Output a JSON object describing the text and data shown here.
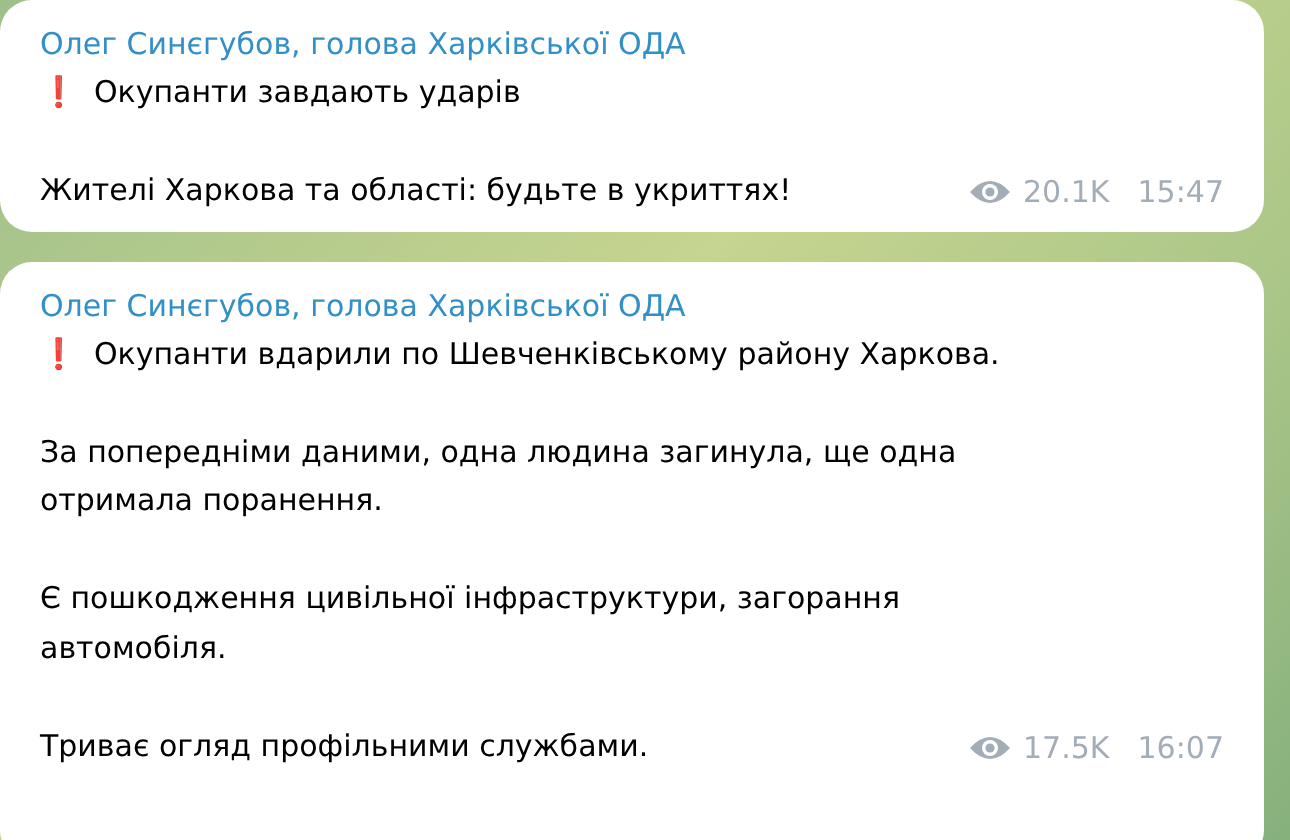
{
  "messages": [
    {
      "author": "Олег Синєгубов, голова Харківської ОДА",
      "alert": "❗",
      "paragraphs": [
        [
          "Окупанти завдають ударів"
        ],
        [
          "Жителі Харкова та області: будьте в укриттях!"
        ]
      ],
      "views": "20.1K",
      "time": "15:47"
    },
    {
      "author": "Олег Синєгубов, голова Харківської ОДА",
      "alert": "❗",
      "paragraphs": [
        [
          "Окупанти вдарили по Шевченківському району Харкова."
        ],
        [
          "За попередніми даними, одна людина загинула, ще одна",
          "отримала поранення."
        ],
        [
          "Є пошкодження цивільної інфраструктури, загорання",
          "автомобіля."
        ],
        [
          "Триває огляд профільними службами."
        ]
      ],
      "views": "17.5K",
      "time": "16:07"
    }
  ]
}
